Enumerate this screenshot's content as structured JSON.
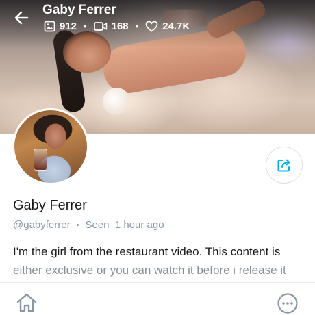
{
  "header": {
    "title": "Gaby Ferrer",
    "stats": {
      "photos": "912",
      "videos": "168",
      "likes": "24.7K"
    },
    "back_icon": "arrow-left-icon",
    "photo_icon": "image-icon",
    "video_icon": "video-icon",
    "like_icon": "heart-icon"
  },
  "profile": {
    "display_name": "Gaby Ferrer",
    "username": "@gabyferrer",
    "separator": "•",
    "last_seen": "Seen  1 hour ago",
    "bio_line1": "I'm the girl from the restaurant video. This content is",
    "bio_line2": "either exclusive or you can watch it before i release it"
  },
  "actions": {
    "share_icon": "share-icon"
  },
  "bottom_nav": {
    "home_icon": "home-icon",
    "more_icon": "more-icon"
  },
  "colors": {
    "accent": "#00aff0",
    "muted_text": "#8a96a3",
    "border": "#dcdde2"
  }
}
